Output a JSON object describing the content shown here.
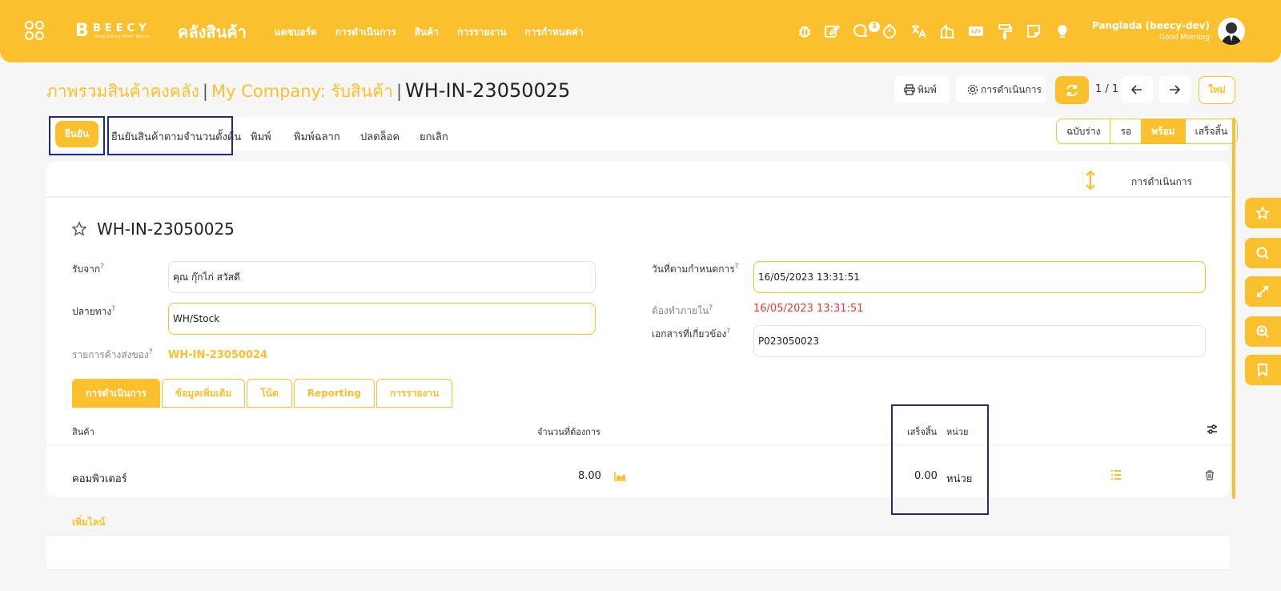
{
  "topbar": {
    "logo_letter": "B",
    "logo_word": "BEECY",
    "logo_tagline": "Step Going Start Beecy",
    "app_title": "คลังสินค้า",
    "nav": [
      "แดชบอร์ด",
      "การดำเนินการ",
      "สินค้า",
      "การรายงาน",
      "การกำหนดค่า"
    ],
    "icons": [
      "bug-icon",
      "edit-icon",
      "chat-icon",
      "stopwatch-icon",
      "translate-icon",
      "building-icon",
      "code-icon",
      "paint-roller-icon",
      "note-icon",
      "lightbulb-icon"
    ],
    "chat_badge": "3",
    "user_name": "Panglada (beecy-dev)",
    "user_greeting": "Good Morning"
  },
  "breadcrumb": {
    "level1": "ภาพรวมสินค้าคงคลัง",
    "level2": "My Company: รับสินค้า",
    "current": "WH-IN-23050025"
  },
  "controls": {
    "print": "พิมพ์",
    "action": "การดำเนินการ",
    "pager": "1 / 1",
    "new": "ใหม่"
  },
  "toolbar": {
    "confirm": "ยืนยัน",
    "confirm_initial": "ยืนยันสินค้าตามจำนวนตั้งต้น",
    "print": "พิมพ์",
    "print_label": "พิมพ์ฉลาก",
    "unlock": "ปลดล็อค",
    "cancel": "ยกเลิก"
  },
  "status": {
    "steps": [
      "ฉบับร่าง",
      "รอ",
      "พร้อม",
      "เสร็จสิ้น"
    ],
    "active": "พร้อม"
  },
  "chatter": {
    "label": "การดำเนินการ"
  },
  "record": {
    "title": "WH-IN-23050025",
    "receive_from_label": "รับจาก",
    "receive_from": "คุณ กุ๊กไก่ สวัสดี",
    "destination_label": "ปลายทาง",
    "destination": "WH/Stock",
    "backorder_label": "รายการค้างส่งของ",
    "backorder": "WH-IN-23050024",
    "scheduled_label": "วันที่ตามกำหนดการ",
    "scheduled": "16/05/2023 13:31:51",
    "deadline_label": "ต้องทำภายใน",
    "deadline": "16/05/2023 13:31:51",
    "source_doc_label": "เอกสารที่เกี่ยวข้อง",
    "source_doc": "P023050023",
    "help_mark": "?"
  },
  "tabs": [
    "การดำเนินการ",
    "ข้อมูลเพิ่มเติม",
    "โน้ต",
    "Reporting",
    "การรายงาน"
  ],
  "table": {
    "headers": {
      "product": "สินค้า",
      "demand": "จำนวนที่ต้องการ",
      "done": "เสร็จสิ้น",
      "unit": "หน่วย"
    },
    "rows": [
      {
        "product": "คอมพิวเตอร์",
        "demand": "8.00",
        "done": "0.00",
        "unit": "หน่วย"
      }
    ],
    "add_line": "เพิ่มไลน์"
  },
  "colors": {
    "accent": "#fbc02d",
    "highlight": "#1f2a80",
    "danger": "#e53935"
  }
}
